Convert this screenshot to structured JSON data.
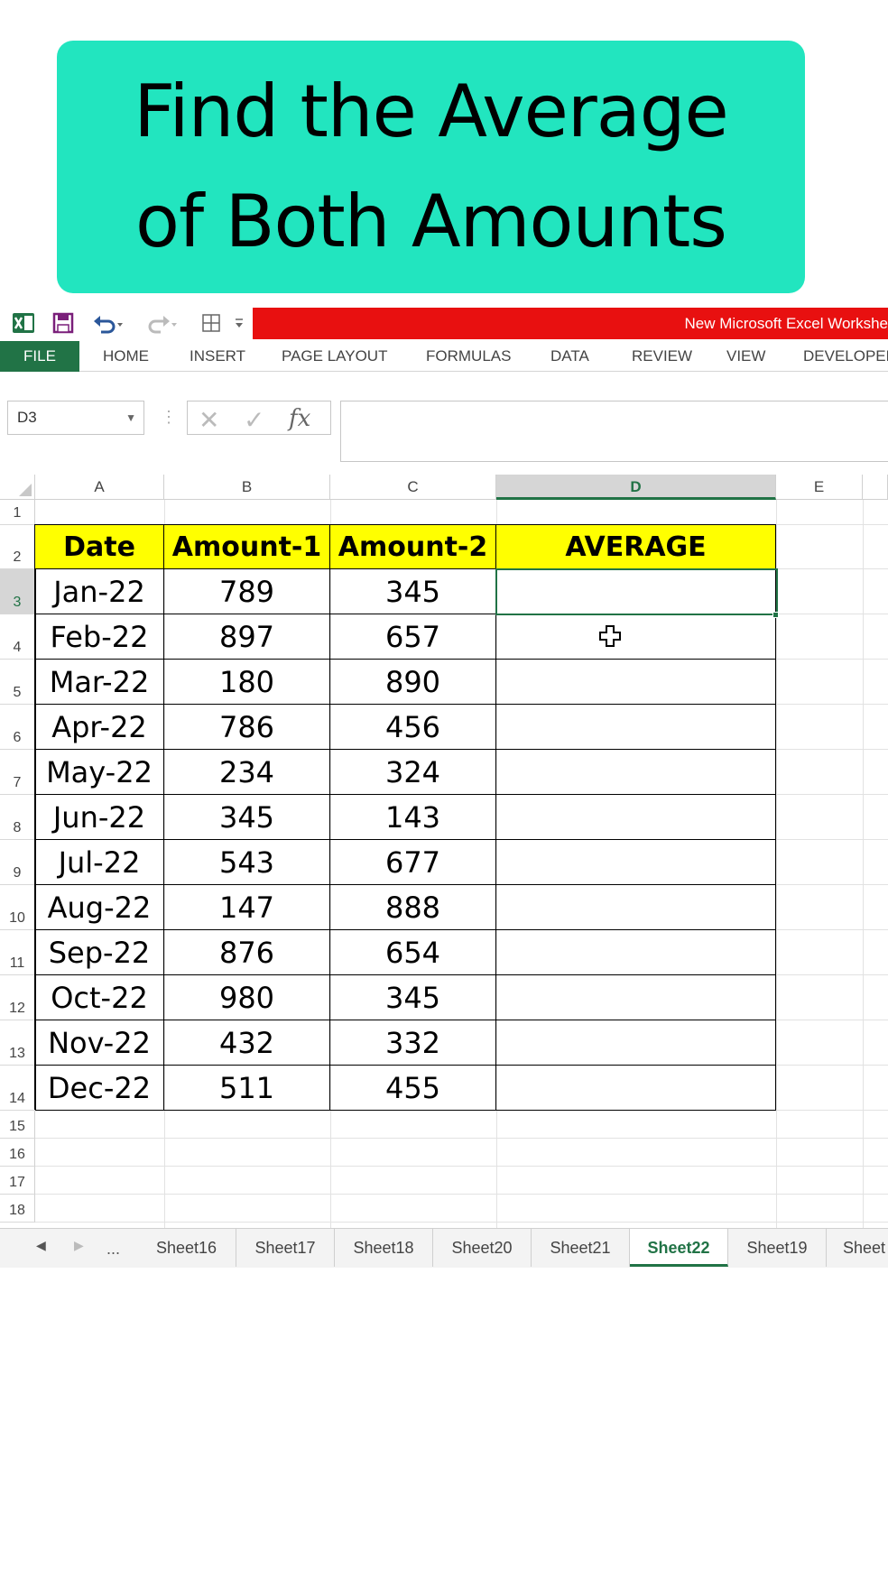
{
  "banner": {
    "line1": "Find the Average",
    "line2": "of Both Amounts"
  },
  "window": {
    "title": "New Microsoft Excel Workshe"
  },
  "ribbon": {
    "tabs": [
      "FILE",
      "HOME",
      "INSERT",
      "PAGE LAYOUT",
      "FORMULAS",
      "DATA",
      "REVIEW",
      "VIEW",
      "DEVELOPER"
    ]
  },
  "formula_bar": {
    "name_box": "D3",
    "formula": ""
  },
  "columns": [
    "A",
    "B",
    "C",
    "D",
    "E"
  ],
  "selected_column": "D",
  "rows": [
    "1",
    "2",
    "3",
    "4",
    "5",
    "6",
    "7",
    "8",
    "9",
    "10",
    "11",
    "12",
    "13",
    "14",
    "15",
    "16",
    "17",
    "18"
  ],
  "table": {
    "headers": [
      "Date",
      "Amount-1",
      "Amount-2",
      "AVERAGE"
    ],
    "data": [
      [
        "Jan-22",
        "789",
        "345",
        ""
      ],
      [
        "Feb-22",
        "897",
        "657",
        ""
      ],
      [
        "Mar-22",
        "180",
        "890",
        ""
      ],
      [
        "Apr-22",
        "786",
        "456",
        ""
      ],
      [
        "May-22",
        "234",
        "324",
        ""
      ],
      [
        "Jun-22",
        "345",
        "143",
        ""
      ],
      [
        "Jul-22",
        "543",
        "677",
        ""
      ],
      [
        "Aug-22",
        "147",
        "888",
        ""
      ],
      [
        "Sep-22",
        "876",
        "654",
        ""
      ],
      [
        "Oct-22",
        "980",
        "345",
        ""
      ],
      [
        "Nov-22",
        "432",
        "332",
        ""
      ],
      [
        "Dec-22",
        "511",
        "455",
        ""
      ]
    ]
  },
  "sheet_tabs": {
    "ellipsis": "...",
    "tabs": [
      "Sheet16",
      "Sheet17",
      "Sheet18",
      "Sheet20",
      "Sheet21",
      "Sheet22",
      "Sheet19",
      "Sheet"
    ],
    "active": "Sheet22"
  },
  "colors": {
    "accent": "#217346",
    "banner": "#22e5bf",
    "header_fill": "#ffff00",
    "title_strip": "#e81010"
  },
  "icons": [
    "excel-logo-icon",
    "save-icon",
    "undo-icon",
    "redo-icon",
    "border-icon",
    "cancel-icon",
    "enter-icon",
    "fx-icon",
    "cursor-icon"
  ]
}
